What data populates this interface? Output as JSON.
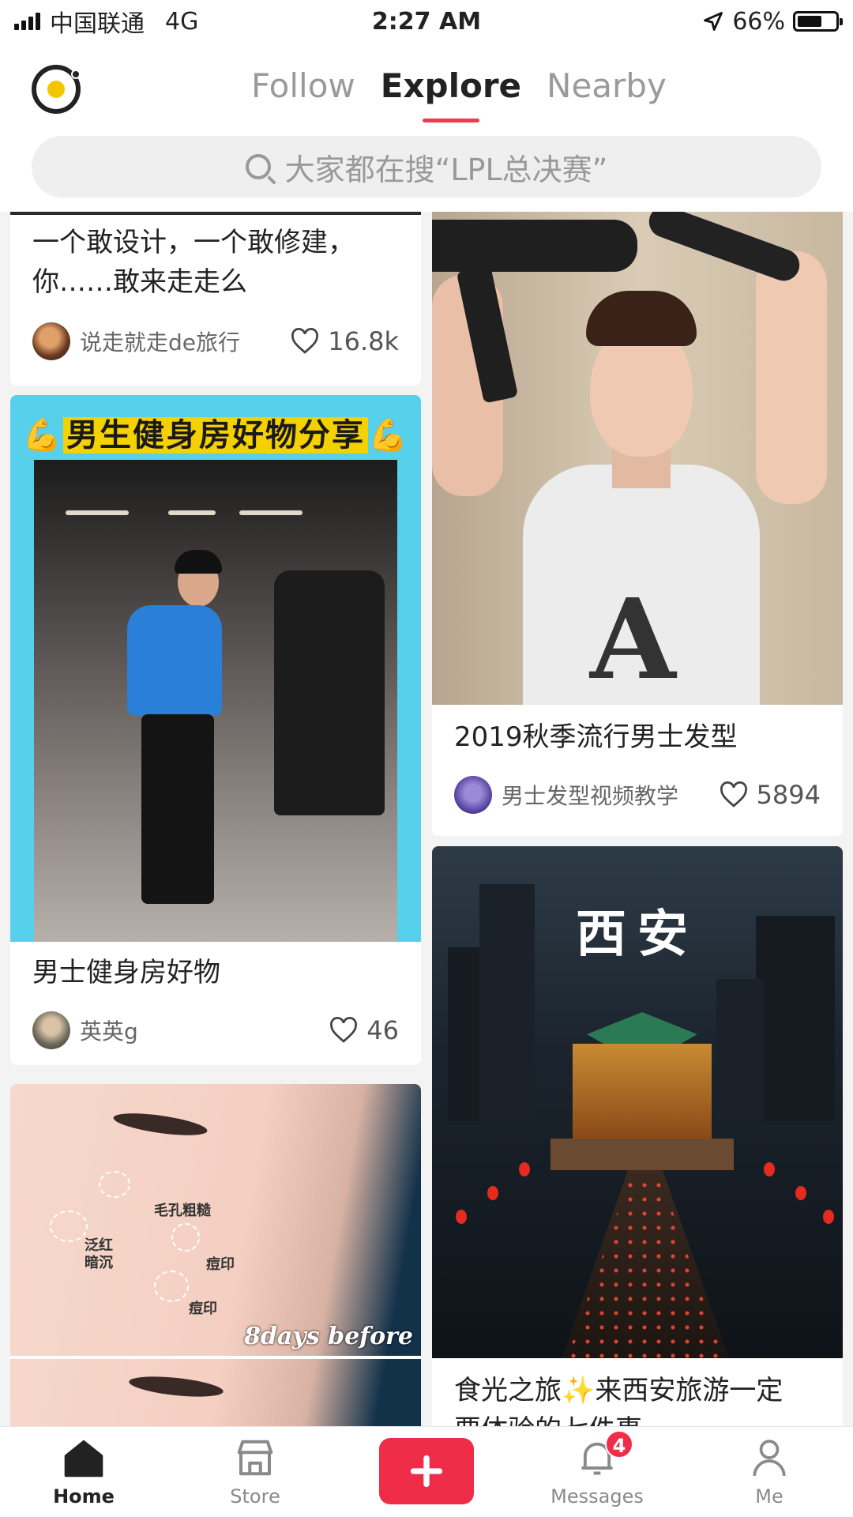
{
  "status_bar": {
    "carrier": "中国联通",
    "network": "4G",
    "time": "2:27 AM",
    "battery": "66%",
    "battery_level": 0.66
  },
  "header": {
    "tabs": [
      {
        "label": "Follow",
        "active": false
      },
      {
        "label": "Explore",
        "active": true
      },
      {
        "label": "Nearby",
        "active": false
      }
    ]
  },
  "search": {
    "placeholder": "大家都在搜“LPL总决赛”"
  },
  "feed": {
    "left": [
      {
        "title": "一个敢设计，一个敢修建，你……敢来走走么",
        "author": "说走就走de旅行",
        "likes": "16.8k"
      },
      {
        "banner": "男生健身房好物分享",
        "title": "男士健身房好物",
        "author": "英英g",
        "likes": "46"
      },
      {
        "labels": [
          "毛孔粗糙",
          "泛红暗沉",
          "痘印",
          "痘印"
        ],
        "caption": "8days before"
      }
    ],
    "right": [
      {
        "title": "2019秋季流行男士发型",
        "author": "男士发型视频教学",
        "likes": "5894"
      },
      {
        "image_text": "西安",
        "title_a": "食光之旅",
        "title_b": "来西安旅游一定",
        "title_line2": "要体验的七件事"
      }
    ]
  },
  "bottom_nav": {
    "items": [
      {
        "label": "Home",
        "icon": "home-icon",
        "active": true
      },
      {
        "label": "Store",
        "icon": "store-icon",
        "active": false
      },
      {
        "label": "Messages",
        "icon": "bell-icon",
        "active": false,
        "badge": "4"
      },
      {
        "label": "Me",
        "icon": "person-icon",
        "active": false
      }
    ],
    "plus_icon": "plus-icon"
  },
  "colors": {
    "accent": "#ef2d48",
    "tab_indicator": "#ef3b4f",
    "logo_dot": "#f3c700"
  }
}
